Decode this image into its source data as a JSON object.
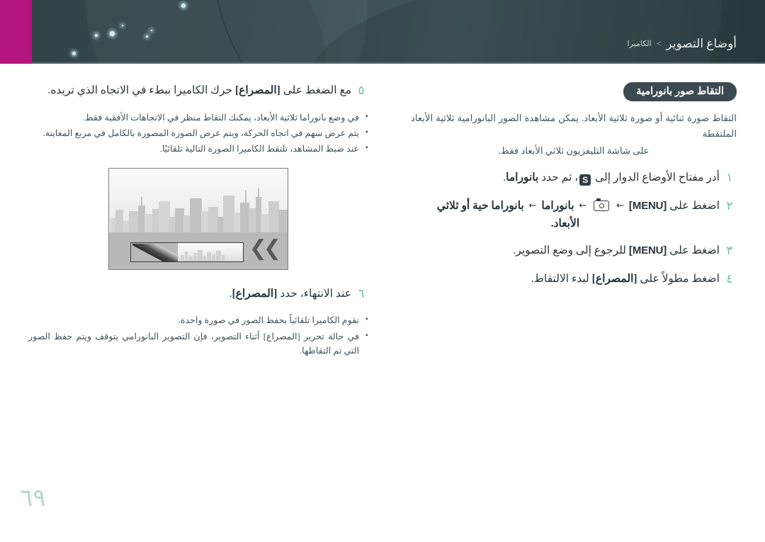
{
  "banner": {
    "breadcrumb_parent": "الكاميرا",
    "breadcrumb_sep": ">",
    "breadcrumb_current": "أوضاع التصوير",
    "magenta_color": "#b3167f",
    "banner_color": "#2e4044"
  },
  "right_column": {
    "section_title": "التقاط صور بانورامية",
    "intro_line1": "التقاط صورة ثنائية أو صورة ثلاثية الأبعاد. يمكن مشاهدة الصور البانورامية ثلاثية الأبعاد الملتقطة",
    "intro_line2": "على شاشة التليفزيون ثلاثي الأبعاد فقط.",
    "steps": [
      {
        "num": "١",
        "pre": "أدر مفتاح الأوضاع الدوار إلى",
        "icon": "S",
        "post": "، ثم حدد",
        "bold": "بانوراما",
        "tail": "."
      },
      {
        "num": "٢",
        "pre": "اضغط على",
        "menu": "[MENU]",
        "arrow": "←",
        "icon": "camera-icon",
        "chain1": "بانوراما",
        "chain2": "بانوراما حية أو ثلاثي",
        "line2": "الأبعاد."
      },
      {
        "num": "٣",
        "pre": "اضغط على",
        "menu": "[MENU]",
        "post": "للرجوع إلى وضع التصوير."
      },
      {
        "num": "٤",
        "pre": "اضغط مطولاً على",
        "bold": "[المصراع]",
        "post": "لبدء الالتقاط."
      }
    ]
  },
  "left_column": {
    "step5": {
      "num": "٥",
      "pre": "مع الضغط على",
      "bold": "[المصراع]",
      "post": "حرك الكاميرا ببطء في الاتجاه الذي تريده."
    },
    "step5_bullets": [
      "في وضع بانوراما ثلاثية الأبعاد، يمكنك التقاط منظر في الاتجاهات الأفقية فقط.",
      "يتم عرض سهم في اتجاه الحركة، ويتم عرض الصورة المصورة بالكامل في مربع المعاينة.",
      "عند ضبط المشاهد، تلتقط الكاميرا الصورة التالية تلقائيًا."
    ],
    "illustration": {
      "alt": "camera-preview-panorama-illustration",
      "chevron": "❯❯"
    },
    "step6": {
      "num": "٦",
      "pre": "عند الانتهاء، حدد",
      "bold": "[المصراع]",
      "post": "."
    },
    "step6_bullets": [
      "تقوم الكاميرا تلقائياً بحفظ الصور في صورة واحدة.",
      "في حالة تحرير [المصراع] أثناء التصوير، فإن التصوير البانورامي يتوقف ويتم حفظ الصور التي تم التقاطها."
    ]
  },
  "footer": {
    "page_number": "٦٩"
  }
}
